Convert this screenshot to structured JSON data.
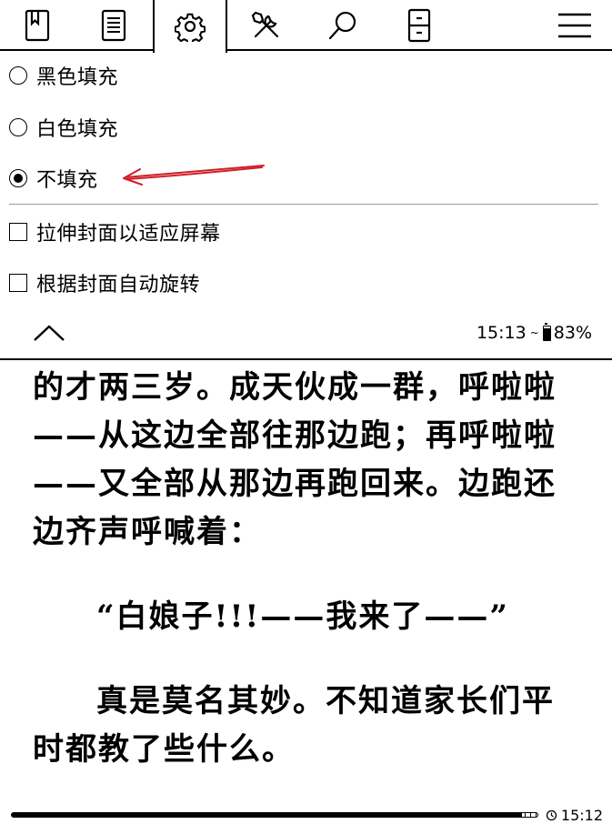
{
  "toolbar": {
    "tabs": [
      {
        "icon": "bookmark-icon"
      },
      {
        "icon": "toc-list-icon"
      },
      {
        "icon": "gear-icon",
        "active": true
      },
      {
        "icon": "tools-icon"
      },
      {
        "icon": "search-icon"
      },
      {
        "icon": "phone-device-icon"
      }
    ],
    "menu_icon": "hamburger-menu-icon"
  },
  "settings": {
    "fill_options": [
      {
        "label": "黑色填充",
        "selected": false
      },
      {
        "label": "白色填充",
        "selected": false
      },
      {
        "label": "不填充",
        "selected": true
      }
    ],
    "checkboxes": [
      {
        "label": "拉伸封面以适应屏幕",
        "checked": false
      },
      {
        "label": "根据封面自动旋转",
        "checked": false
      }
    ],
    "annotation_arrow_color": "#d0202a"
  },
  "status": {
    "time": "15:13",
    "wifi_symbol": "~",
    "battery_percent": "83%",
    "battery_level": 0.83
  },
  "reading": {
    "paragraphs": [
      "的才两三岁。成天伙成一群，呼啦啦——从这边全部往那边跑；再呼啦啦——又全部从那边再跑回来。边跑还边齐声呼喊着：",
      "“白娘子!!!——我来了——”",
      "真是莫名其妙。不知道家长们平时都教了些什么。"
    ]
  },
  "footer": {
    "clock": "15:12",
    "progress_fraction": 0.97
  }
}
